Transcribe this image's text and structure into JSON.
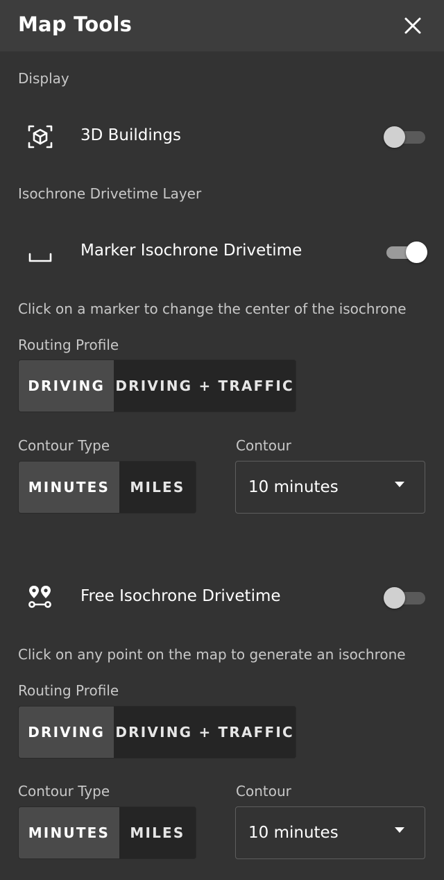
{
  "header": {
    "title": "Map Tools",
    "close_icon": "close-icon"
  },
  "display": {
    "section_label": "Display",
    "buildings": {
      "label": "3D Buildings",
      "icon": "cube-scan-icon",
      "enabled": false
    }
  },
  "isochrone": {
    "section_label": "Isochrone Drivetime Layer",
    "marker": {
      "label": "Marker Isochrone Drivetime",
      "icon": "marker-bracket-icon",
      "enabled": true,
      "hint": "Click on a marker to change the center of the isochrone",
      "routing_label": "Routing Profile",
      "routing_options": [
        "DRIVING",
        "DRIVING + TRAFFIC"
      ],
      "routing_selected": "DRIVING",
      "contour_type_label": "Contour Type",
      "contour_type_options": [
        "MINUTES",
        "MILES"
      ],
      "contour_type_selected": "MINUTES",
      "contour_label": "Contour",
      "contour_value": "10 minutes"
    },
    "free": {
      "label": "Free Isochrone Drivetime",
      "icon": "route-pins-icon",
      "enabled": false,
      "hint": "Click on any point on the map to generate an isochrone",
      "routing_label": "Routing Profile",
      "routing_options": [
        "DRIVING",
        "DRIVING + TRAFFIC"
      ],
      "routing_selected": "DRIVING",
      "contour_type_label": "Contour Type",
      "contour_type_options": [
        "MINUTES",
        "MILES"
      ],
      "contour_type_selected": "MINUTES",
      "contour_label": "Contour",
      "contour_value": "10 minutes"
    }
  },
  "colors": {
    "background": "#333333",
    "header": "#3d3d3d",
    "segment_active": "#4a4a4a",
    "segment_inactive": "#252525"
  }
}
